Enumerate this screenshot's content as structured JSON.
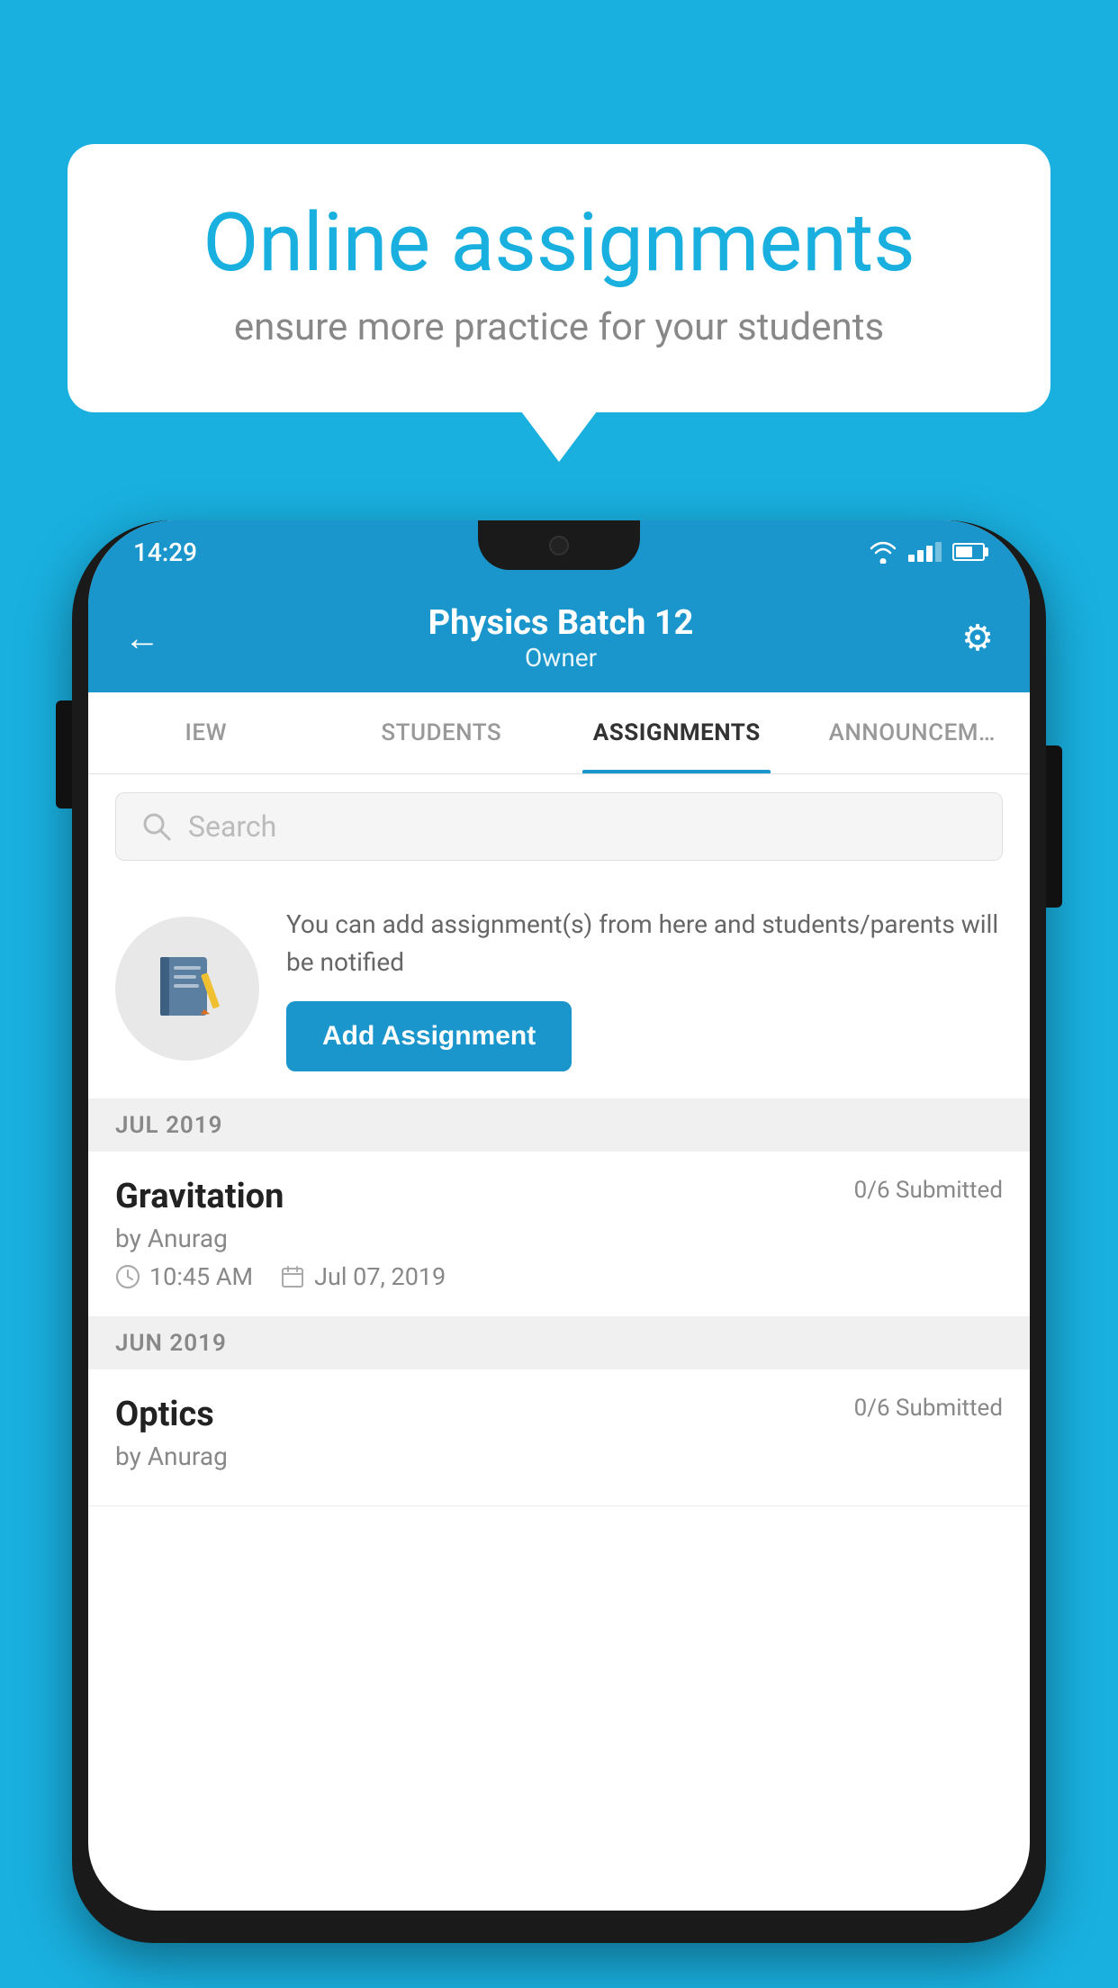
{
  "background_color": "#19b0e0",
  "bubble": {
    "title": "Online assignments",
    "subtitle": "ensure more practice for your students"
  },
  "status_bar": {
    "time": "14:29",
    "wifi": "▾",
    "battery_pct": 65
  },
  "header": {
    "title": "Physics Batch 12",
    "subtitle": "Owner",
    "back_label": "←",
    "settings_label": "⚙"
  },
  "tabs": [
    {
      "label": "IEW",
      "active": false
    },
    {
      "label": "STUDENTS",
      "active": false
    },
    {
      "label": "ASSIGNMENTS",
      "active": true
    },
    {
      "label": "ANNOUNCEM…",
      "active": false
    }
  ],
  "search": {
    "placeholder": "Search"
  },
  "promo": {
    "description": "You can add assignment(s) from here and students/parents will be notified",
    "button_label": "Add Assignment"
  },
  "sections": [
    {
      "label": "JUL 2019",
      "assignments": [
        {
          "name": "Gravitation",
          "submitted": "0/6 Submitted",
          "by": "by Anurag",
          "time": "10:45 AM",
          "date": "Jul 07, 2019"
        }
      ]
    },
    {
      "label": "JUN 2019",
      "assignments": [
        {
          "name": "Optics",
          "submitted": "0/6 Submitted",
          "by": "by Anurag",
          "time": "",
          "date": ""
        }
      ]
    }
  ]
}
